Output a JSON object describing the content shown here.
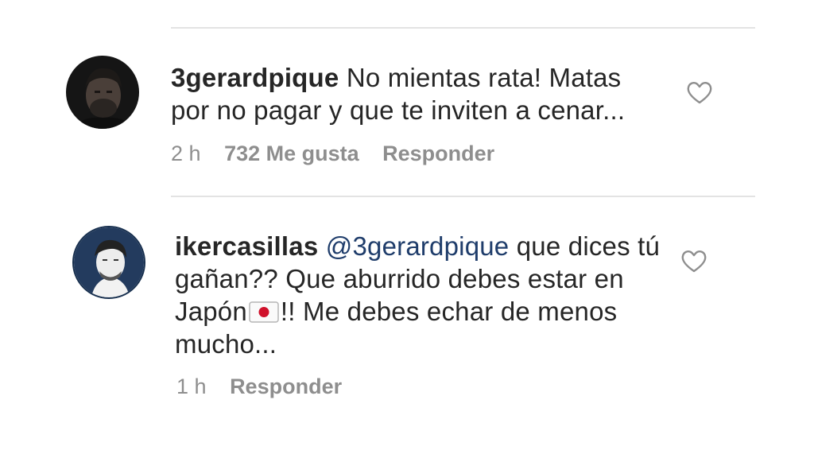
{
  "comments": [
    {
      "username": "3gerardpique",
      "text": "No mientas rata! Matas por no pagar y que te inviten a cenar...",
      "time": "2 h",
      "likes": "732 Me gusta",
      "reply_label": "Responder",
      "avatar_icon": "profile-photo",
      "like_icon": "heart-outline-icon"
    },
    {
      "username": "ikercasillas",
      "mention": "@3gerardpique",
      "text_before_flag": "que dices tú gañan?? Que aburrido debes estar en Japón",
      "flag_emoji": "🇯🇵",
      "text_after_flag": "!! Me debes echar de menos mucho...",
      "time": "1 h",
      "reply_label": "Responder",
      "avatar_icon": "profile-illustration",
      "like_icon": "heart-outline-icon"
    }
  ],
  "colors": {
    "text": "#262626",
    "meta": "#8e8e8e",
    "mention": "#1f3d6b",
    "divider": "#e3e3e3"
  }
}
